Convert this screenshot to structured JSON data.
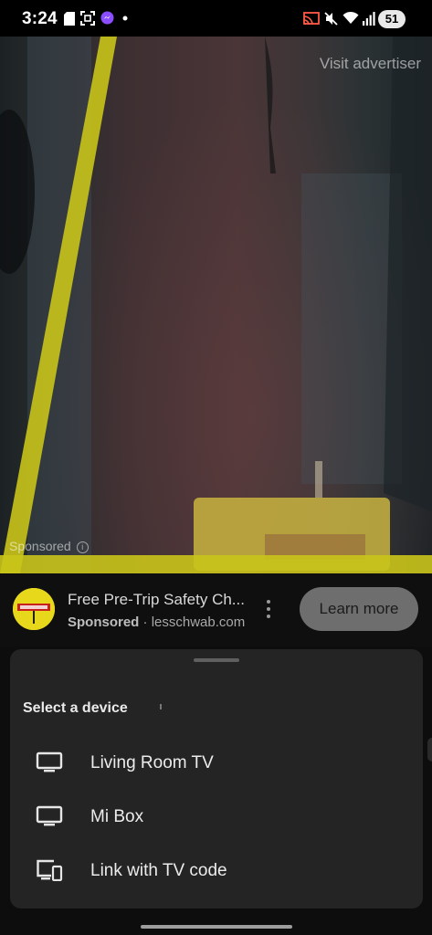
{
  "status_bar": {
    "time": "3:24",
    "left_icons": [
      "sim-card-icon",
      "screenshot-icon",
      "messenger-icon",
      "dot-icon"
    ],
    "right_icons": [
      "cast-icon",
      "mute-icon",
      "wifi-icon",
      "signal-icon"
    ],
    "battery": "51"
  },
  "video": {
    "visit_advertiser": "Visit advertiser",
    "sponsored_label": "Sponsored",
    "accent_color": "#c9c41a"
  },
  "ad": {
    "title": "Free Pre-Trip Safety Ch...",
    "sponsored": "Sponsored",
    "separator": "·",
    "domain": "lesschwab.com",
    "cta": "Learn more"
  },
  "sheet": {
    "title": "Select a device",
    "devices": [
      {
        "label": "Living Room TV",
        "icon": "tv-icon"
      },
      {
        "label": "Mi Box",
        "icon": "tv-icon"
      },
      {
        "label": "Link with TV code",
        "icon": "tv-and-phone-icon"
      }
    ]
  }
}
